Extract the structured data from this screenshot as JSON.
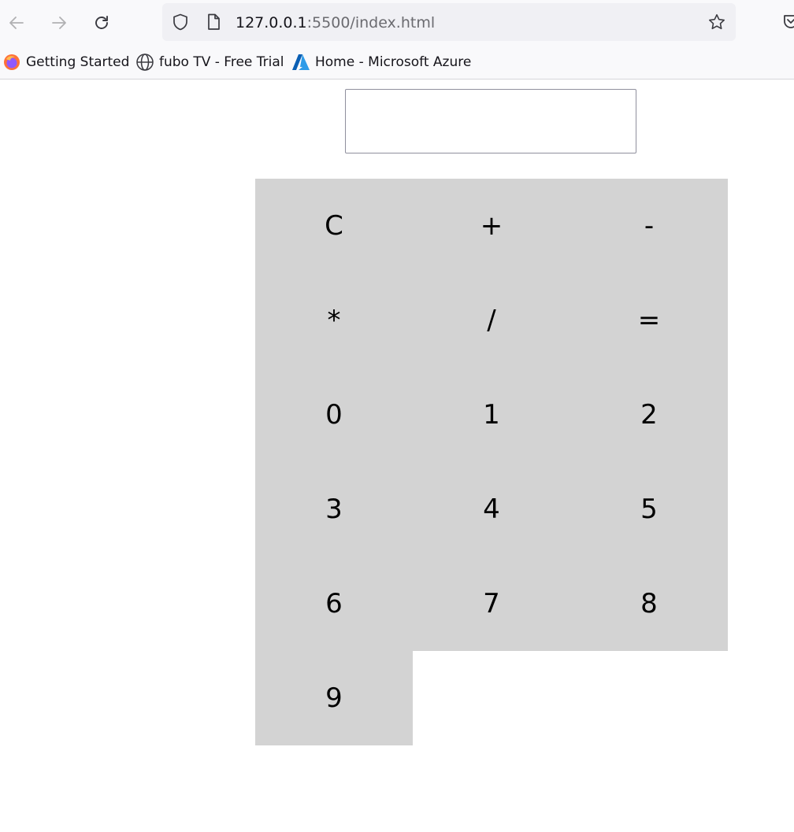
{
  "browser": {
    "url_host": "127.0.0.1",
    "url_rest": ":5500/index.html",
    "bookmarks": [
      {
        "label": "Getting Started",
        "icon": "firefox-icon"
      },
      {
        "label": "fubo TV - Free Trial",
        "icon": "globe-icon"
      },
      {
        "label": "Home - Microsoft Azure",
        "icon": "azure-icon"
      }
    ]
  },
  "calculator": {
    "display_value": "",
    "keys": [
      "C",
      "+",
      "-",
      "*",
      "/",
      "=",
      "0",
      "1",
      "2",
      "3",
      "4",
      "5",
      "6",
      "7",
      "8",
      "9"
    ]
  },
  "colors": {
    "key_background": "#d3d3d3",
    "toolbar_background": "#f9f9fb",
    "urlbar_background": "#f0f0f4"
  }
}
